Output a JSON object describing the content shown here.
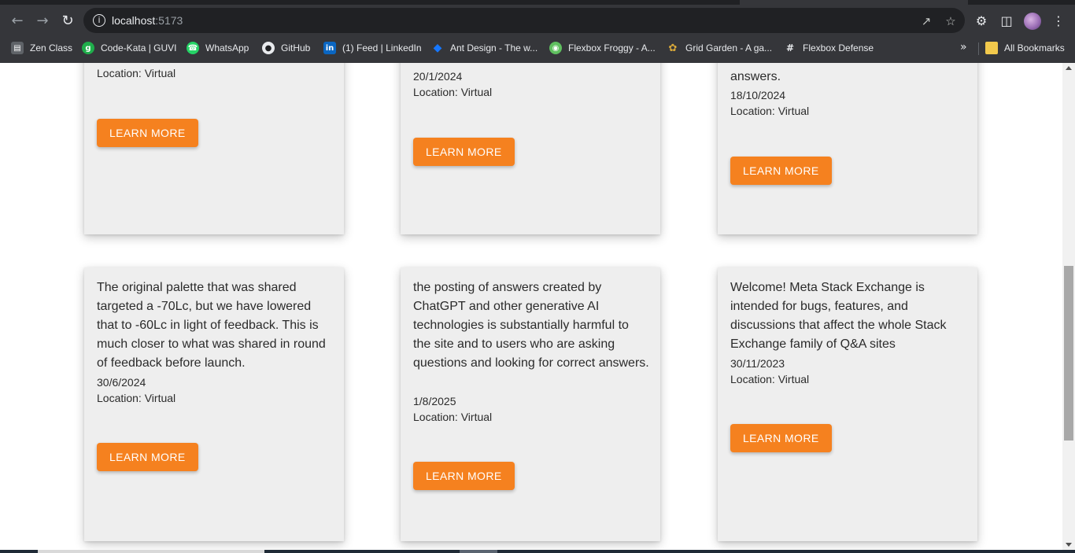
{
  "browser": {
    "url_host": "localhost",
    "url_port": ":5173",
    "bookmarks": [
      {
        "label": "Zen Class",
        "icon": "zen-class-icon",
        "color": "#3c4043"
      },
      {
        "label": "Code-Kata | GUVI",
        "icon": "guvi-icon",
        "color": "#1fae4b"
      },
      {
        "label": "WhatsApp",
        "icon": "whatsapp-icon",
        "color": "#25d366"
      },
      {
        "label": "GitHub",
        "icon": "github-icon",
        "color": "#e8eaed"
      },
      {
        "label": "(1) Feed | LinkedIn",
        "icon": "linkedin-icon",
        "color": "#0a66c2"
      },
      {
        "label": "Ant Design - The w...",
        "icon": "ant-design-icon",
        "color": "#1677ff"
      },
      {
        "label": "Flexbox Froggy - A...",
        "icon": "froggy-icon",
        "color": "#5fbf5f"
      },
      {
        "label": "Grid Garden - A ga...",
        "icon": "grid-garden-icon",
        "color": "#d9a93a"
      },
      {
        "label": "Flexbox Defense",
        "icon": "flexbox-defense-icon",
        "color": "#e8eaed"
      }
    ],
    "all_bookmarks": "All Bookmarks"
  },
  "cards": [
    {
      "desc": "",
      "date": "",
      "location": "Location: Virtual",
      "button": "LEARN MORE"
    },
    {
      "desc": "",
      "date": "20/1/2024",
      "location": "Location: Virtual",
      "button": "LEARN MORE"
    },
    {
      "desc": "answers.",
      "date": "18/10/2024",
      "location": "Location: Virtual",
      "button": "LEARN MORE"
    },
    {
      "desc": "The original palette that was shared targeted a -70Lc, but we have lowered that to -60Lc in light of feedback. This is much closer to what was shared in round of feedback before launch.",
      "date": "30/6/2024",
      "location": "Location: Virtual",
      "button": "LEARN MORE"
    },
    {
      "desc": "the posting of answers created by ChatGPT and other generative AI technologies is substantially harmful to the site and to users who are asking questions and looking for correct answers.",
      "date": "1/8/2025",
      "location": "Location: Virtual",
      "button": "LEARN MORE"
    },
    {
      "desc": "Welcome! Meta Stack Exchange is intended for bugs, features, and discussions that affect the whole Stack Exchange family of Q&A sites",
      "date": "30/11/2023",
      "location": "Location: Virtual",
      "button": "LEARN MORE"
    }
  ],
  "colors": {
    "accent": "#f5811f",
    "card_bg": "#eeeeee"
  }
}
